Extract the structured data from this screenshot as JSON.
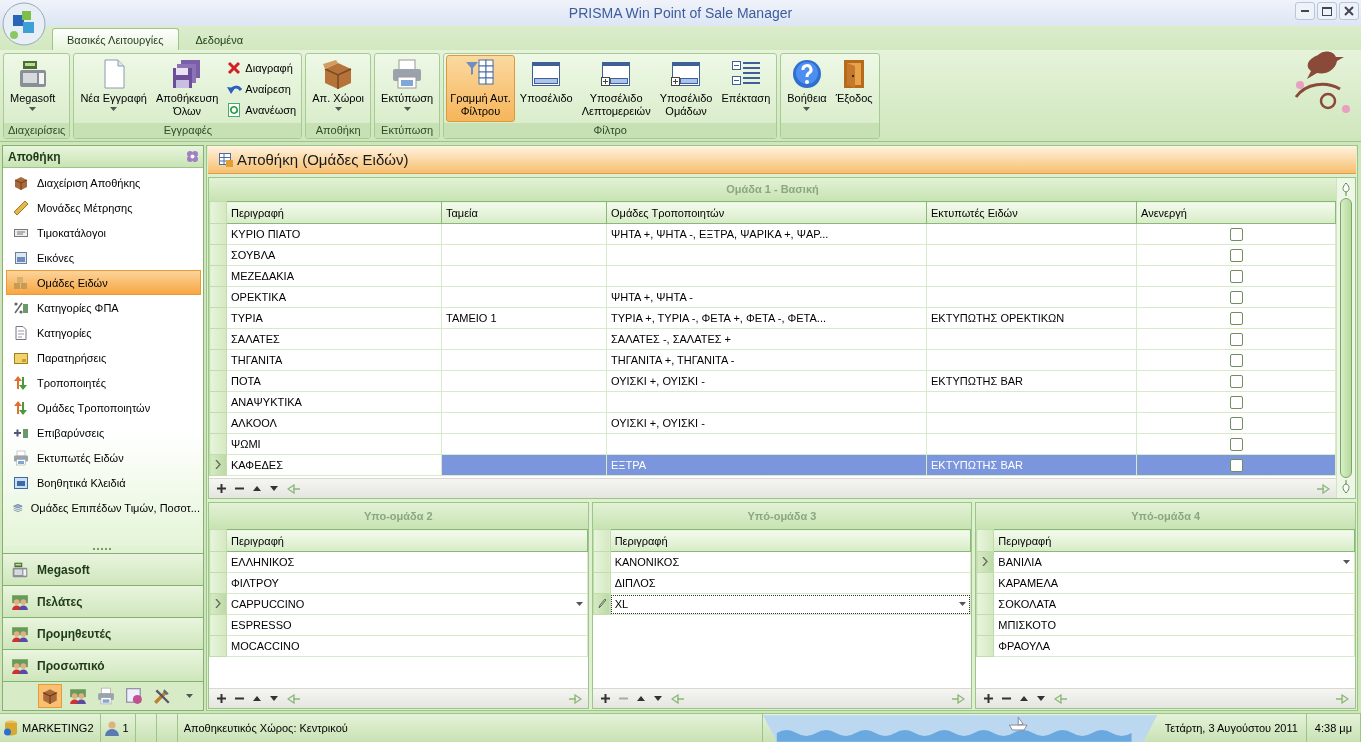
{
  "window": {
    "title": "PRISMA Win Point of Sale Manager"
  },
  "ribbon": {
    "tabs": [
      {
        "label": "Βασικές Λειτουργίες",
        "selected": true
      },
      {
        "label": "Δεδομένα",
        "selected": false
      }
    ],
    "groups": [
      {
        "label": "Διαχειρίσεις",
        "buttons": [
          {
            "kind": "large",
            "label": "Megasoft",
            "has_menu": true,
            "selected": false
          }
        ]
      },
      {
        "label": "Εγγραφές",
        "buttons": [
          {
            "kind": "large",
            "label": "Νέα Εγγραφή",
            "has_menu": true,
            "selected": false
          },
          {
            "kind": "large",
            "label": "Αποθήκευση\nΌλων",
            "has_menu": false,
            "selected": false
          },
          {
            "kind": "small",
            "label": "Διαγραφή",
            "has_menu": false,
            "selected": false
          },
          {
            "kind": "small",
            "label": "Αναίρεση",
            "has_menu": false,
            "selected": false
          },
          {
            "kind": "small",
            "label": "Ανανέωση",
            "has_menu": false,
            "selected": false
          }
        ]
      },
      {
        "label": "Αποθήκη",
        "buttons": [
          {
            "kind": "large",
            "label": "Απ. Χώροι",
            "has_menu": true,
            "selected": false
          }
        ]
      },
      {
        "label": "Εκτύπωση",
        "buttons": [
          {
            "kind": "large",
            "label": "Εκτύπωση",
            "has_menu": true,
            "selected": false
          }
        ]
      },
      {
        "label": "Φίλτρο",
        "buttons": [
          {
            "kind": "large",
            "label": "Γραμμή Αυτ.\nΦίλτρου",
            "has_menu": false,
            "selected": true
          },
          {
            "kind": "large",
            "label": "Υποσέλιδο",
            "has_menu": false,
            "selected": false
          },
          {
            "kind": "large",
            "label": "Υποσέλιδο\nΛεπτομερειών",
            "has_menu": false,
            "selected": false
          },
          {
            "kind": "large",
            "label": "Υποσέλιδο\nΟμάδων",
            "has_menu": false,
            "selected": false
          },
          {
            "kind": "large",
            "label": "Επέκταση",
            "has_menu": false,
            "selected": false
          }
        ]
      },
      {
        "buttons": [
          {
            "kind": "large",
            "label": "Βοήθεια",
            "has_menu": true,
            "selected": false
          },
          {
            "kind": "large",
            "label": "Έξοδος",
            "has_menu": false,
            "selected": false
          }
        ]
      }
    ]
  },
  "sidebar": {
    "title": "Αποθήκη",
    "items": [
      {
        "label": "Διαχείριση Αποθήκης",
        "selected": false
      },
      {
        "label": "Μονάδες Μέτρησης",
        "selected": false
      },
      {
        "label": "Τιμοκατάλογοι",
        "selected": false
      },
      {
        "label": "Εικόνες",
        "selected": false
      },
      {
        "label": "Ομάδες Ειδών",
        "selected": true
      },
      {
        "label": "Κατηγορίες ΦΠΑ",
        "selected": false
      },
      {
        "label": "Κατηγορίες",
        "selected": false
      },
      {
        "label": "Παρατηρήσεις",
        "selected": false
      },
      {
        "label": "Τροποποιητές",
        "selected": false
      },
      {
        "label": "Ομάδες Τροποποιητών",
        "selected": false
      },
      {
        "label": "Επιβαρύνσεις",
        "selected": false
      },
      {
        "label": "Εκτυπωτές Ειδών",
        "selected": false
      },
      {
        "label": "Βοηθητικά Κλειδιά",
        "selected": false
      },
      {
        "label": "Ομάδες Επιπέδων Τιμών, Ποσοτ...",
        "selected": false
      }
    ],
    "sections": [
      {
        "label": "Megasoft"
      },
      {
        "label": "Πελάτες"
      },
      {
        "label": "Προμηθευτές"
      },
      {
        "label": "Προσωπικό"
      }
    ],
    "bottom_icons": [
      {
        "selected": true
      },
      {
        "selected": false
      },
      {
        "selected": false
      },
      {
        "selected": false
      },
      {
        "selected": false
      }
    ]
  },
  "content": {
    "title": "Αποθήκη (Ομάδες Ειδών)",
    "main_grid": {
      "caption": "Ομάδα 1 - Βασική",
      "columns": [
        {
          "label": "Περιγραφή"
        },
        {
          "label": "Ταμεία"
        },
        {
          "label": "Ομάδες Τροποποιητών"
        },
        {
          "label": "Εκτυπωτές Ειδών"
        },
        {
          "label": "Ανενεργή"
        }
      ],
      "rows": [
        {
          "description": "ΚΥΡΙΟ ΠΙΑΤΟ",
          "modifier_groups": "ΨΗΤΑ +, ΨΗΤΑ -, ΕΞΤΡΑ, ΨΑΡΙΚΑ +, ΨΑΡ...",
          "inactive": false,
          "selected": false
        },
        {
          "description": "ΣΟΥΒΛΑ",
          "inactive": false,
          "selected": false
        },
        {
          "description": "ΜΕΖΕΔΑΚΙΑ",
          "inactive": false,
          "selected": false
        },
        {
          "description": "ΟΡΕΚΤΙΚΑ",
          "modifier_groups": "ΨΗΤΑ +, ΨΗΤΑ -",
          "inactive": false,
          "selected": false
        },
        {
          "description": "ΤΥΡΙΑ",
          "registers": "ΤΑΜΕΙΟ 1",
          "modifier_groups": "ΤΥΡΙΑ +, ΤΥΡΙΑ -, ΦΕΤΑ +, ΦΕΤΑ -, ΦΕΤΑ...",
          "item_printers": "ΕΚΤΥΠΩΤΗΣ ΟΡΕΚΤΙΚΩΝ",
          "inactive": false,
          "selected": false
        },
        {
          "description": "ΣΑΛΑΤΕΣ",
          "modifier_groups": "ΣΑΛΑΤΕΣ -, ΣΑΛΑΤΕΣ +",
          "inactive": false,
          "selected": false
        },
        {
          "description": "ΤΗΓΑΝΙΤΑ",
          "modifier_groups": "ΤΗΓΑΝΙΤΑ +, ΤΗΓΑΝΙΤΑ -",
          "inactive": false,
          "selected": false
        },
        {
          "description": "ΠΟΤΑ",
          "modifier_groups": "ΟΥΙΣΚΙ +, ΟΥΙΣΚΙ -",
          "item_printers": "ΕΚΤΥΠΩΤΗΣ BAR",
          "inactive": false,
          "selected": false
        },
        {
          "description": "ΑΝΑΨΥΚΤΙΚΑ",
          "inactive": false,
          "selected": false
        },
        {
          "description": "ΑΛΚΟΟΛ",
          "modifier_groups": "ΟΥΙΣΚΙ +, ΟΥΙΣΚΙ -",
          "inactive": false,
          "selected": false
        },
        {
          "description": "ΨΩΜΙ",
          "inactive": false,
          "selected": false
        },
        {
          "description": "ΚΑΦΕΔΕΣ",
          "modifier_groups": "ΕΞΤΡΑ",
          "item_printers": "ΕΚΤΥΠΩΤΗΣ BAR",
          "inactive": false,
          "selected": true
        }
      ]
    },
    "sub_grids": [
      {
        "caption": "Υπο-ομάδα 2",
        "column": "Περιγραφή",
        "remove_disabled": false,
        "rows": [
          {
            "text": "ΕΛΛΗΝΙΚΟΣ",
            "selected": false,
            "editing": false
          },
          {
            "text": "ΦΙΛΤΡΟΥ",
            "selected": false,
            "editing": false
          },
          {
            "text": "CAPPUCCINO",
            "selected": true,
            "editing": false
          },
          {
            "text": "ESPRESSO",
            "selected": false,
            "editing": false
          },
          {
            "text": "MOCACCINO",
            "selected": false,
            "editing": false
          }
        ]
      },
      {
        "caption": "Υπό-ομάδα 3",
        "column": "Περιγραφή",
        "remove_disabled": true,
        "rows": [
          {
            "text": "ΚΑΝΟΝΙΚΟΣ",
            "selected": false,
            "editing": false
          },
          {
            "text": "ΔΙΠΛΟΣ",
            "selected": false,
            "editing": false
          },
          {
            "text": "XL",
            "selected": true,
            "editing": true
          }
        ]
      },
      {
        "caption": "Υπό-ομάδα 4",
        "column": "Περιγραφή",
        "remove_disabled": false,
        "rows": [
          {
            "text": "ΒΑΝΙΛΙΑ",
            "selected": true,
            "editing": false
          },
          {
            "text": "ΚΑΡΑΜΕΛΑ",
            "selected": false,
            "editing": false
          },
          {
            "text": "ΣΟΚΟΛΑΤΑ",
            "selected": false,
            "editing": false
          },
          {
            "text": "ΜΠΙΣΚΟΤΟ",
            "selected": false,
            "editing": false
          },
          {
            "text": "ΦΡΑΟΥΛΑ",
            "selected": false,
            "editing": false
          }
        ]
      }
    ]
  },
  "status_bar": {
    "panels": [
      {
        "kind": "icon_text",
        "text": "MARKETING2"
      },
      {
        "kind": "icon_text",
        "text": "1"
      },
      {
        "kind": "empty"
      },
      {
        "kind": "empty"
      },
      {
        "kind": "text",
        "text": "Αποθηκευτικός Χώρος: Κεντρικού"
      },
      {
        "kind": "wave"
      },
      {
        "kind": "text",
        "text": "Τετάρτη, 3 Αυγούστου 2011"
      },
      {
        "kind": "text",
        "text": "4:38 μμ"
      }
    ]
  }
}
